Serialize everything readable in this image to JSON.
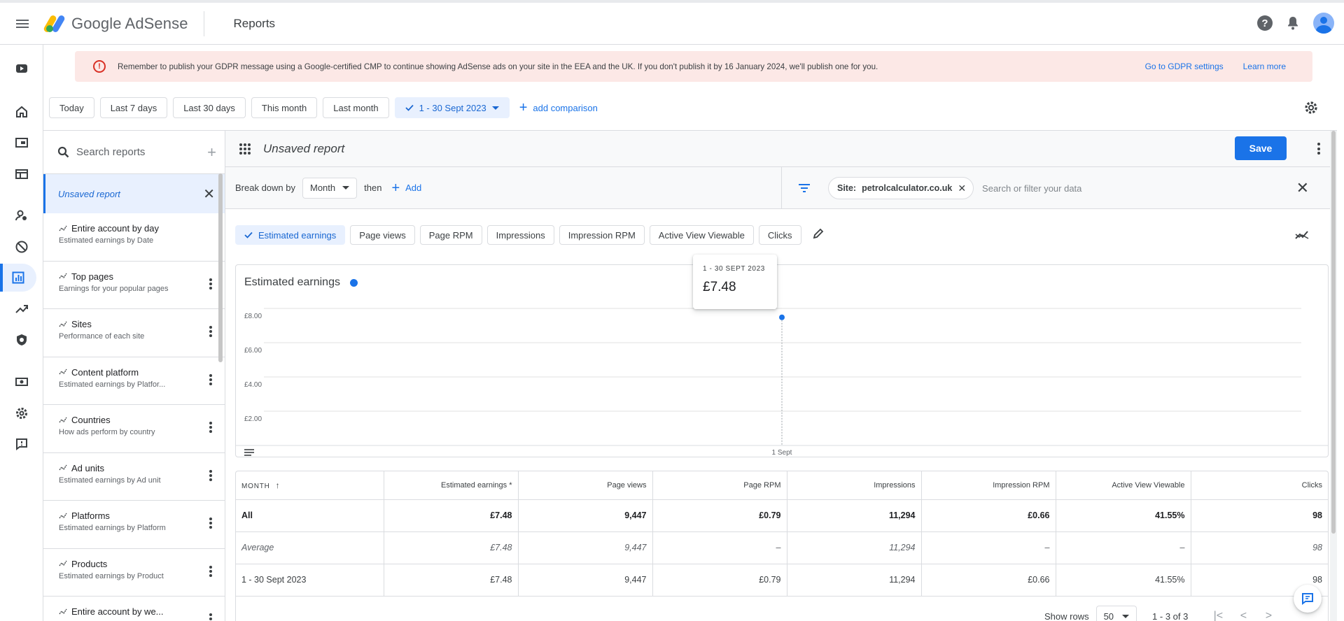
{
  "app": {
    "name": "Google AdSense",
    "page_title": "Reports"
  },
  "banner": {
    "message": "Remember to publish your GDPR message using a Google-certified CMP to continue showing AdSense ads on your site in the EEA and the UK. If you don't publish it by 16 January 2024, we'll publish one for you.",
    "link1": "Go to GDPR settings",
    "link2": "Learn more"
  },
  "date_range": {
    "chips": [
      "Today",
      "Last 7 days",
      "Last 30 days",
      "This month",
      "Last month"
    ],
    "selected": "1 - 30 Sept 2023",
    "add_comparison": "add comparison"
  },
  "sidebar": {
    "search_placeholder": "Search reports",
    "unsaved": "Unsaved report",
    "items": [
      {
        "title": "Entire account by day",
        "subtitle": "Estimated earnings by Date"
      },
      {
        "title": "Top pages",
        "subtitle": "Earnings for your popular pages"
      },
      {
        "title": "Sites",
        "subtitle": "Performance of each site"
      },
      {
        "title": "Content platform",
        "subtitle": "Estimated earnings by Platfor..."
      },
      {
        "title": "Countries",
        "subtitle": "How ads perform by country"
      },
      {
        "title": "Ad units",
        "subtitle": "Estimated earnings by Ad unit"
      },
      {
        "title": "Platforms",
        "subtitle": "Estimated earnings by Platform"
      },
      {
        "title": "Products",
        "subtitle": "Estimated earnings by Product"
      },
      {
        "title": "Entire account by we...",
        "subtitle": ""
      }
    ]
  },
  "report": {
    "name": "Unsaved report",
    "save_label": "Save",
    "breakdown_label": "Break down by",
    "breakdown_value": "Month",
    "then_label": "then",
    "add_label": "Add",
    "filter_chip_key": "Site:",
    "filter_chip_value": "petrolcalculator.co.uk",
    "filter_placeholder": "Search or filter your data",
    "metrics": [
      "Estimated earnings",
      "Page views",
      "Page RPM",
      "Impressions",
      "Impression RPM",
      "Active View Viewable",
      "Clicks"
    ],
    "selected_metric": "Estimated earnings"
  },
  "chart_data": {
    "type": "line",
    "title": "Estimated earnings",
    "x": [
      "1 Sept"
    ],
    "series": [
      {
        "values": [
          7.48
        ]
      }
    ],
    "ylim": [
      0,
      8
    ],
    "yticks": [
      "£8.00",
      "£6.00",
      "£4.00",
      "£2.00"
    ],
    "grid": true,
    "color": "#1a73e8"
  },
  "tooltip": {
    "date": "1 - 30 SEPT 2023",
    "value": "£7.48"
  },
  "table": {
    "columns": [
      "MONTH",
      "Estimated earnings *",
      "Page views",
      "Page RPM",
      "Impressions",
      "Impression RPM",
      "Active View Viewable",
      "Clicks"
    ],
    "rows": [
      [
        "All",
        "£7.48",
        "9,447",
        "£0.79",
        "11,294",
        "£0.66",
        "41.55%",
        "98"
      ],
      [
        "Average",
        "£7.48",
        "9,447",
        "–",
        "11,294",
        "–",
        "–",
        "98"
      ],
      [
        "1 - 30 Sept 2023",
        "£7.48",
        "9,447",
        "£0.79",
        "11,294",
        "£0.66",
        "41.55%",
        "98"
      ]
    ]
  },
  "pagination": {
    "show_rows_label": "Show rows",
    "rows_value": "50",
    "range": "1 - 3 of 3"
  }
}
